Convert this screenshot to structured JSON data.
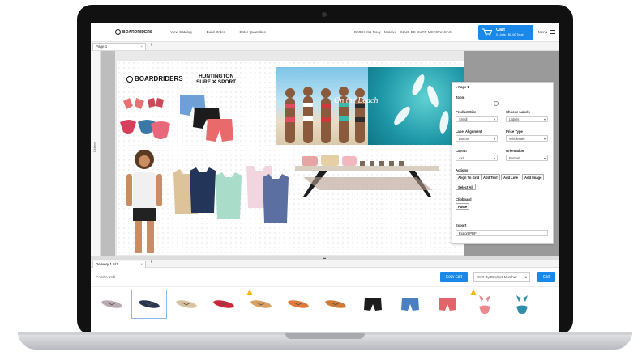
{
  "header": {
    "logo_text": "BOARDRIDERS",
    "nav": [
      "View Catalog",
      "Build Order",
      "Enter Quantities"
    ],
    "store_info": "DMEX 211 Roxy - Maldive - CLUB DE SURF MERONACAS",
    "cart_title": "Cart",
    "cart_sub": "0 Units | $0.00 Total",
    "menu_label": "Menu"
  },
  "page_tab": {
    "label": "Page 1",
    "close": "×",
    "add": "+"
  },
  "side_label": "Delivery",
  "board": {
    "brand_left": "BOARDRIDERS",
    "brand_right_line1": "HUNTINGTON",
    "brand_right_line2": "SURF ✕ SPORT",
    "beach_title": "On the Beach"
  },
  "panel": {
    "heading": "▾ Page 1",
    "zoom_label": "Zoom",
    "product_size_label": "Product Size",
    "product_size_value": "Small",
    "choose_labels_label": "Choose Labels",
    "choose_labels_value": "Labels",
    "label_alignment_label": "Label Alignment",
    "label_alignment_value": "Bottom",
    "price_type_label": "Price Type",
    "price_type_value": "Wholesale",
    "layout_label": "Layout",
    "layout_value": "4x4",
    "orientation_label": "Orientation",
    "orientation_value": "Portrait",
    "actions_label": "Actions",
    "actions": [
      "Align To Grid",
      "Add Text",
      "Add Line",
      "Add Image",
      "Select All"
    ],
    "clipboard_label": "Clipboard",
    "paste": "Paste",
    "export_label": "Export",
    "export_pdf": "Export PDF"
  },
  "delivery": {
    "tab_label": "Delivery 1 5/1",
    "close": "×",
    "add": "+",
    "combo_label": "Combo Atoll",
    "copy_cart": "Copy Cart",
    "sort_value": "Sort By Product Number",
    "cart_button": "Cart"
  },
  "thumbnails": [
    {
      "name": "sandal-grey",
      "color": "#b9a9b5"
    },
    {
      "name": "sandal-navy",
      "color": "#2b3550"
    },
    {
      "name": "sandal-beige",
      "color": "#d9c2a0"
    },
    {
      "name": "sandal-red",
      "color": "#c9293a"
    },
    {
      "name": "sandal-tan",
      "color": "#d8a060"
    },
    {
      "name": "sandal-orange",
      "color": "#e07a3a"
    },
    {
      "name": "sandal-brown",
      "color": "#cf7b35"
    },
    {
      "name": "shorts-black",
      "color": "#1d1d1d"
    },
    {
      "name": "shorts-blue",
      "color": "#4a7fc0"
    },
    {
      "name": "shorts-coral",
      "color": "#e2656a"
    },
    {
      "name": "bikini-floral",
      "color": "#e98a90"
    },
    {
      "name": "bikini-teal",
      "color": "#2f8fa8"
    }
  ],
  "colors": {
    "accent": "#1a88e8",
    "warning": "#f4b400"
  }
}
